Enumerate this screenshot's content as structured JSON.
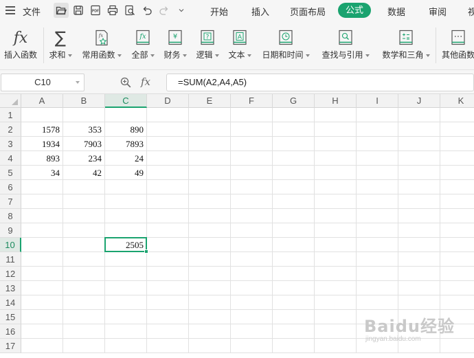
{
  "menubar": {
    "file_label": "文件",
    "tabs": [
      {
        "label": "开始"
      },
      {
        "label": "插入"
      },
      {
        "label": "页面布局"
      },
      {
        "label": "公式",
        "active": true
      },
      {
        "label": "数据"
      },
      {
        "label": "审阅"
      },
      {
        "label": "视"
      }
    ],
    "quick_access": [
      "folder-open-icon",
      "save-icon",
      "pdf-icon",
      "print-icon",
      "print-preview-icon",
      "undo-icon",
      "redo-icon",
      "customize-dropdown-icon"
    ]
  },
  "ribbon": {
    "buttons": [
      {
        "label": "插入函数",
        "icon": "fx-icon",
        "dropdown": false
      },
      {
        "label": "求和",
        "icon": "sigma-icon",
        "dropdown": true
      },
      {
        "label": "常用函数",
        "icon": "star-function-icon",
        "dropdown": true
      },
      {
        "label": "全部",
        "icon": "fx-book-icon",
        "dropdown": true
      },
      {
        "label": "财务",
        "icon": "yen-book-icon",
        "dropdown": true
      },
      {
        "label": "逻辑",
        "icon": "question-book-icon",
        "dropdown": true
      },
      {
        "label": "文本",
        "icon": "text-book-icon",
        "dropdown": true
      },
      {
        "label": "日期和时间",
        "icon": "clock-book-icon",
        "dropdown": true
      },
      {
        "label": "查找与引用",
        "icon": "search-book-icon",
        "dropdown": true
      },
      {
        "label": "数学和三角",
        "icon": "math-book-icon",
        "dropdown": true
      },
      {
        "label": "其他函数",
        "icon": "more-book-icon",
        "dropdown": false
      }
    ]
  },
  "formula_bar": {
    "name_box": "C10",
    "fx_label": "fx",
    "formula": "=SUM(A2,A4,A5)"
  },
  "sheet": {
    "columns": [
      "A",
      "B",
      "C",
      "D",
      "E",
      "F",
      "G",
      "H",
      "I",
      "J",
      "K"
    ],
    "rows": [
      "1",
      "2",
      "3",
      "4",
      "5",
      "6",
      "7",
      "8",
      "9",
      "10",
      "11",
      "12",
      "13",
      "14",
      "15",
      "16",
      "17"
    ],
    "cells": [
      {
        "ref": "A2",
        "value": "1578"
      },
      {
        "ref": "B2",
        "value": "353"
      },
      {
        "ref": "C2",
        "value": "890"
      },
      {
        "ref": "A3",
        "value": "1934"
      },
      {
        "ref": "B3",
        "value": "7903"
      },
      {
        "ref": "C3",
        "value": "7893"
      },
      {
        "ref": "A4",
        "value": "893"
      },
      {
        "ref": "B4",
        "value": "234"
      },
      {
        "ref": "C4",
        "value": "24"
      },
      {
        "ref": "A5",
        "value": "34"
      },
      {
        "ref": "B5",
        "value": "42"
      },
      {
        "ref": "C5",
        "value": "49"
      },
      {
        "ref": "C10",
        "value": "2505"
      }
    ],
    "active_cell": "C10",
    "accent_color": "#1aa36f"
  },
  "watermark": {
    "text": "Baidu经验",
    "sub": "jingyan.baidu.com"
  }
}
